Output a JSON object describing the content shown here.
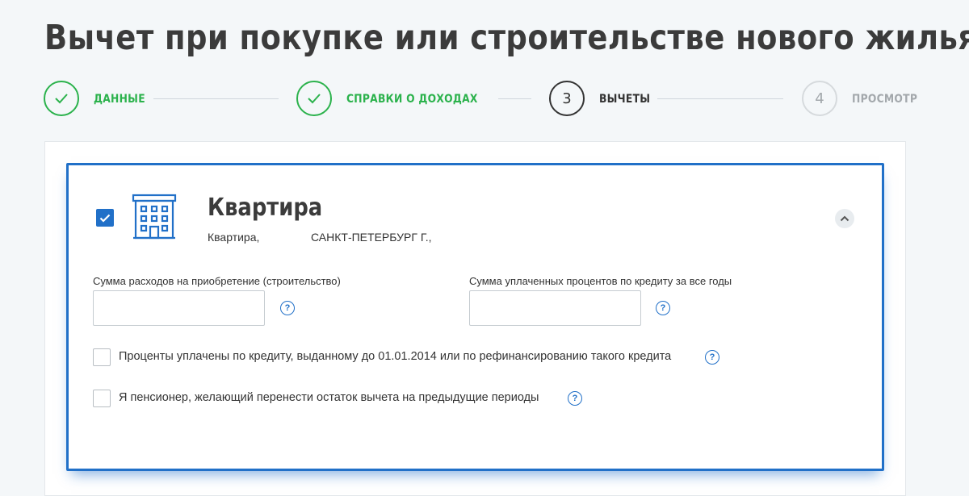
{
  "page": {
    "title": "Вычет при покупке или строительстве нового жилья"
  },
  "stepper": {
    "steps": [
      {
        "label": "ДАННЫЕ",
        "state": "done",
        "number": ""
      },
      {
        "label": "СПРАВКИ О ДОХОДАХ",
        "state": "done",
        "number": ""
      },
      {
        "label": "ВЫЧЕТЫ",
        "state": "active",
        "number": "3"
      },
      {
        "label": "ПРОСМОТР",
        "state": "pending",
        "number": "4"
      }
    ]
  },
  "property": {
    "checked": true,
    "icon": "building-icon",
    "title": "Квартира",
    "type": "Квартира,",
    "city": "САНКТ-ПЕТЕРБУРГ Г.,"
  },
  "fields": {
    "purchase_amount": {
      "label": "Сумма расходов на приобретение (строительство)",
      "value": "",
      "placeholder": ""
    },
    "interest_amount": {
      "label": "Сумма уплаченных процентов по кредиту за все годы",
      "value": "",
      "placeholder": ""
    }
  },
  "checkboxes": {
    "refinance": {
      "label": "Проценты уплачены по кредиту, выданному до 01.01.2014 или по рефинансированию такого кредита",
      "checked": false
    },
    "pensioner": {
      "label": "Я пенсионер, желающий перенести остаток вычета на предыдущие периоды",
      "checked": false
    }
  },
  "help_glyph": "?",
  "colors": {
    "accent": "#2170c8",
    "done": "#2bb24c",
    "text": "#333333",
    "muted": "#a3a8ac"
  }
}
